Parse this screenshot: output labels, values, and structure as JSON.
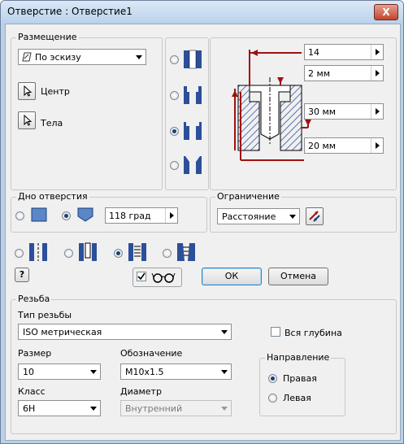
{
  "window": {
    "title": "Отверстие : Отверстие1",
    "close_label": "X"
  },
  "placement": {
    "group_label": "Размещение",
    "method_value": "По эскизу",
    "center_label": "Центр",
    "bodies_label": "Тела"
  },
  "diagram": {
    "dim1_value": "14",
    "dim2_value": "2 мм",
    "dim3_value": "30 мм",
    "dim4_value": "20 мм"
  },
  "bottom": {
    "group_label": "Дно отверстия",
    "angle_value": "118 град"
  },
  "termination": {
    "group_label": "Ограничение",
    "value": "Расстояние"
  },
  "buttons": {
    "ok_label": "ОК",
    "cancel_label": "Отмена",
    "help_label": "?"
  },
  "thread": {
    "group_label": "Резьба",
    "type_label": "Тип резьбы",
    "type_value": "ISO метрическая",
    "full_depth_label": "Вся глубина",
    "size_label": "Размер",
    "size_value": "10",
    "designation_label": "Обозначение",
    "designation_value": "M10x1.5",
    "class_label": "Класс",
    "class_value": "6H",
    "diameter_label": "Диаметр",
    "diameter_value": "Внутренний",
    "direction_label": "Направление",
    "right_label": "Правая",
    "left_label": "Левая"
  },
  "colors": {
    "dimension": "#a01010",
    "hatch": "#2b4f9a",
    "accent": "#1a3f78"
  },
  "selection": {
    "hole_type": "counterbore",
    "bottom": "angle",
    "hole_thread": "tapped",
    "direction": "right",
    "full_depth": false,
    "glasses_checked": true
  }
}
